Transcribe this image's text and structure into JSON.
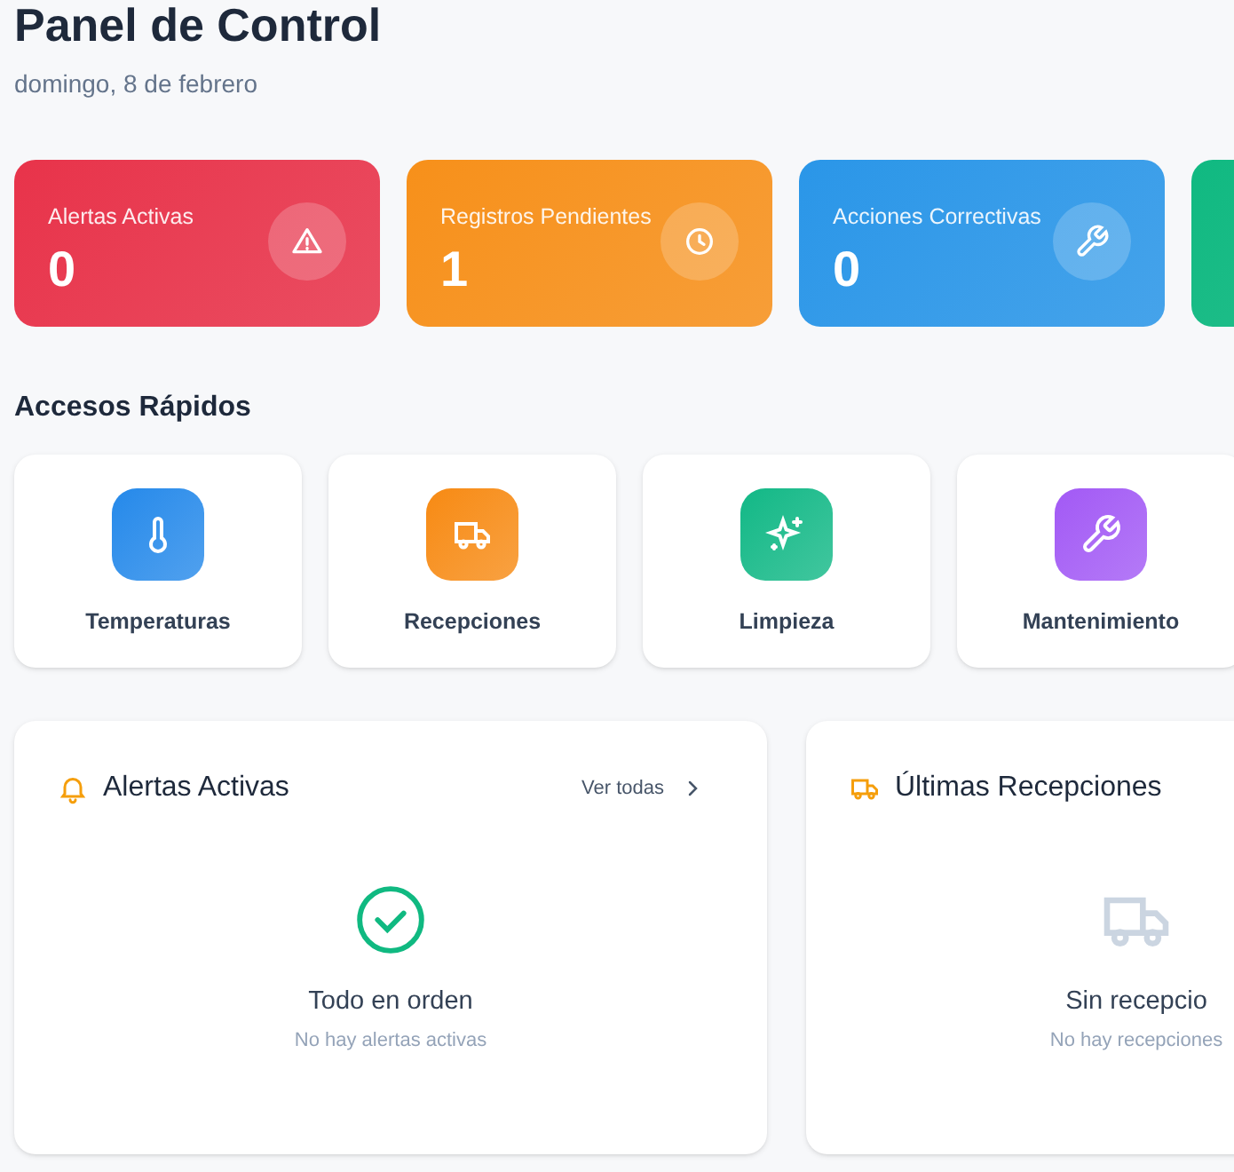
{
  "header": {
    "title": "Panel de Control",
    "date": "domingo, 8 de febrero"
  },
  "stats": [
    {
      "label": "Alertas Activas",
      "value": "0",
      "kind": "alert",
      "color": "#e8334a"
    },
    {
      "label": "Registros Pendientes",
      "value": "1",
      "kind": "clock",
      "color": "#f7901a"
    },
    {
      "label": "Acciones Correctivas",
      "value": "0",
      "kind": "wrench",
      "color": "#2a96e8"
    },
    {
      "kind": "none",
      "color": "#10b981"
    }
  ],
  "quick_access": {
    "title": "Accesos Rápidos",
    "items": [
      {
        "label": "Temperaturas",
        "kind": "thermometer",
        "color": "#2589ea"
      },
      {
        "label": "Recepciones",
        "kind": "truck",
        "color": "#f78a13"
      },
      {
        "label": "Limpieza",
        "kind": "sparkles",
        "color": "#12b886"
      },
      {
        "label": "Mantenimiento",
        "kind": "wrench",
        "color": "#a259f5"
      }
    ]
  },
  "panels": [
    {
      "title": "Alertas Activas",
      "kind": "bell",
      "link": "Ver todas",
      "empty": {
        "kind": "check",
        "title": "Todo en orden",
        "text": "No hay alertas activas"
      }
    },
    {
      "title": "Últimas Recepciones",
      "kind": "truck",
      "empty": {
        "kind": "truck",
        "title": "Sin recepcio",
        "text": "No hay recepciones"
      }
    }
  ]
}
